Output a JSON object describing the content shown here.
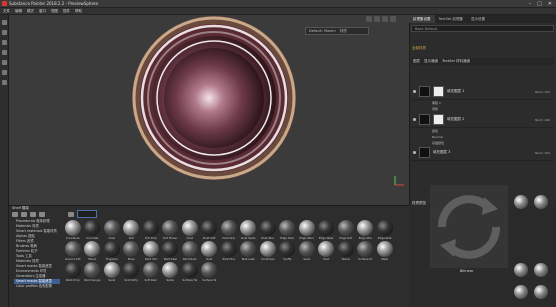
{
  "window": {
    "title": "Substance Painter 2018.2.2 - PreviewSphere"
  },
  "menu": [
    "文件",
    "编辑",
    "模式",
    "窗口",
    "视图",
    "插件",
    "帮助"
  ],
  "viewport": {
    "toolbar": {
      "mode": "Default: Maxim",
      "channel": "材质"
    }
  },
  "right_panel": {
    "tabs": [
      "纹理集设置",
      "TextSet 纹理集",
      "显示设置"
    ],
    "search": "Base  Default",
    "section": "全部材质",
    "props_header": [
      "图层",
      "显示通道",
      "TextSet 材料通道"
    ],
    "layers": [
      {
        "name": "填充图层 1",
        "blend": "Norm 100"
      },
      {
        "name": "填充图层 2",
        "blend": "Norm 100"
      },
      {
        "name": "填充图层 3",
        "blend": "Norm 100"
      }
    ],
    "sub_rows": [
      "掩膜 1",
      "调整",
      "颜色",
      "Normal",
      "基础颜色",
      "粗糙度"
    ],
    "group_name": "填充图层"
  },
  "shelf": {
    "title": "Shelf 展架",
    "categories": [
      "Procedurals 程序纹理",
      "Materials 材质",
      "Smart materials 智能材质",
      "Alphas 透贴",
      "Filters 滤镜",
      "Brushes 笔刷",
      "Particles 粒子",
      "Tools 工具",
      "Materials 材质",
      "Smart masks 智能遮罩",
      "Environments 环境",
      "Generators 生成器",
      "Smart masks 智能遮罩",
      "Color profiles 色彩配置"
    ],
    "selected_category": 12,
    "items": [
      "Curvature",
      "Concrete",
      "Dust",
      "Dirt",
      "Dirt Drip",
      "Dirt Brown",
      "Dust",
      "Dust Soft",
      "Dust Drip",
      "Dust Spots",
      "Dust Tenc",
      "Edge Dam",
      "Edge Worn",
      "Edge Wear",
      "Edge Dirt",
      "Edge Stre",
      "Edge Rust",
      "Ground Dirt",
      "Fibers",
      "Fingerpri",
      "Moss",
      "Paint Old",
      "Paint Peel",
      "Paint Rust",
      "Rust",
      "Rust Fine",
      "Rust Leak",
      "Scratches",
      "Scuffs",
      "Sand",
      "Soot",
      "Stains",
      "Surface Di",
      "Wear",
      "Paint Drop",
      "Paint Gouge",
      "Sand",
      "Soot Dirty",
      "Soft Dam",
      "Spots",
      "Surface Ha",
      "Surface W"
    ]
  },
  "bottom_right": {
    "title": "材质预览",
    "preview_label": "Bilinear"
  }
}
